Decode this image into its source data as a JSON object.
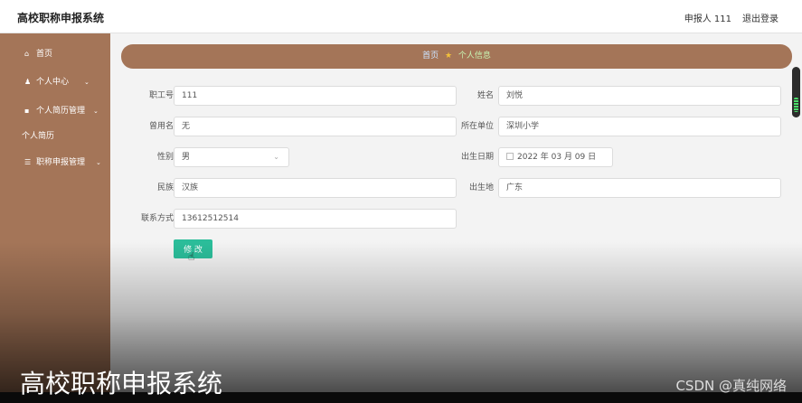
{
  "header": {
    "title": "高校职称申报系统",
    "user": "申报人 111",
    "logout": "退出登录"
  },
  "sidebar": {
    "items": [
      {
        "icon": "home-icon",
        "glyph": "⌂",
        "label": "首页"
      },
      {
        "icon": "user-icon",
        "glyph": "♟",
        "label": "个人中心",
        "chevron": "⌄"
      },
      {
        "icon": "resume-icon",
        "glyph": "▪",
        "label": "个人简历管理",
        "chevron": "⌄"
      },
      {
        "icon": "list-icon",
        "glyph": "☰",
        "label": "职称申报管理",
        "chevron": "⌄"
      }
    ],
    "sub_item": "个人简历"
  },
  "breadcrumb": {
    "home": "首页",
    "star": "★",
    "current": "个人信息"
  },
  "form": {
    "employee_id": {
      "label": "职工号",
      "value": "111"
    },
    "name": {
      "label": "姓名",
      "value": "刘悦"
    },
    "former_name": {
      "label": "曾用名",
      "value": "无"
    },
    "work_unit": {
      "label": "所在单位",
      "value": "深圳小学"
    },
    "gender": {
      "label": "性别",
      "value": "男"
    },
    "birth_date": {
      "label": "出生日期",
      "value": "2022 年 03 月 09 日"
    },
    "ethnicity": {
      "label": "民族",
      "value": "汉族"
    },
    "birthplace": {
      "label": "出生地",
      "value": "广东"
    },
    "contact": {
      "label": "联系方式",
      "value": "13612512514"
    },
    "save_label": "修 改"
  },
  "overlay": {
    "caption": "高校职称申报系统",
    "watermark": "CSDN @真纯网络"
  },
  "colors": {
    "sidebar": "#a47558",
    "accent": "#2bbd9a"
  }
}
